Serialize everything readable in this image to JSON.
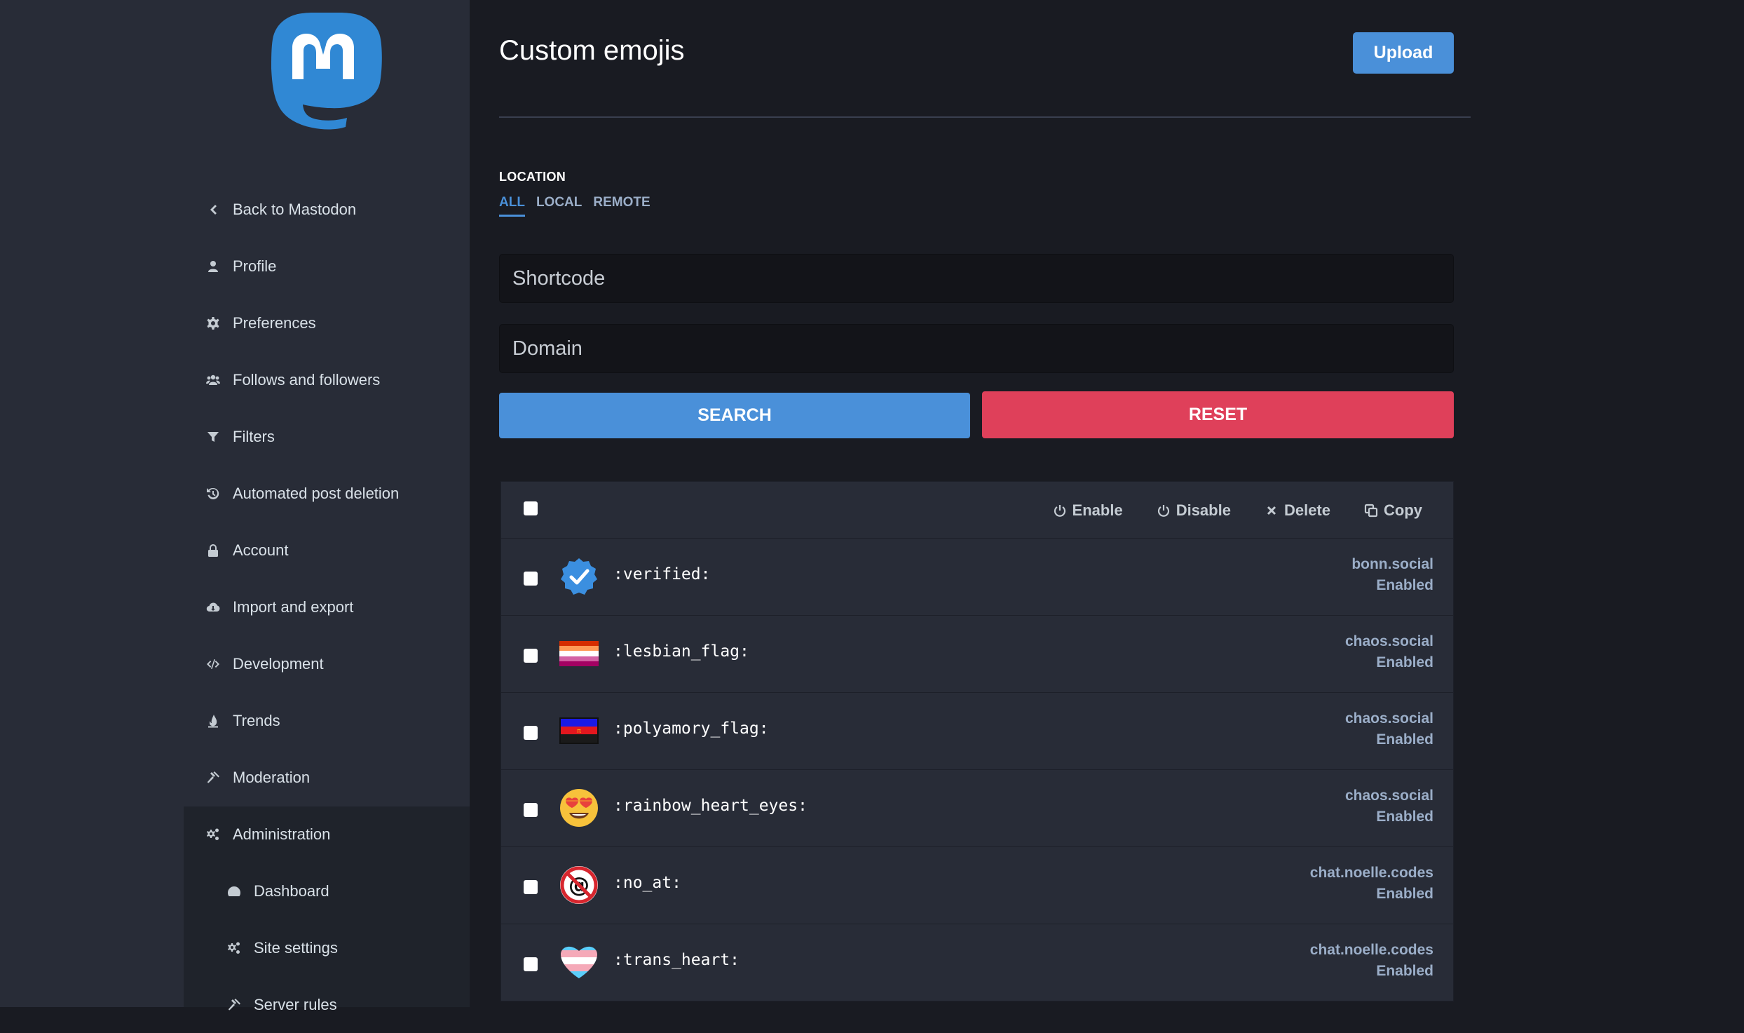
{
  "sidebar": {
    "logo": "mastodon-logo",
    "items": [
      {
        "label": "Back to Mastodon",
        "icon": "chevron-left-icon"
      },
      {
        "label": "Profile",
        "icon": "user-icon"
      },
      {
        "label": "Preferences",
        "icon": "cog-icon"
      },
      {
        "label": "Follows and followers",
        "icon": "users-icon"
      },
      {
        "label": "Filters",
        "icon": "filter-icon"
      },
      {
        "label": "Automated post deletion",
        "icon": "history-icon"
      },
      {
        "label": "Account",
        "icon": "lock-icon"
      },
      {
        "label": "Import and export",
        "icon": "cloud-download-icon"
      },
      {
        "label": "Development",
        "icon": "code-icon"
      },
      {
        "label": "Trends",
        "icon": "fire-icon"
      },
      {
        "label": "Moderation",
        "icon": "gavel-icon"
      },
      {
        "label": "Administration",
        "icon": "cogs-icon"
      },
      {
        "label": "Dashboard",
        "icon": "tachometer-icon"
      },
      {
        "label": "Site settings",
        "icon": "cogs-icon"
      },
      {
        "label": "Server rules",
        "icon": "gavel-icon"
      }
    ]
  },
  "header": {
    "title": "Custom emojis",
    "upload_label": "Upload"
  },
  "filter": {
    "heading": "LOCATION",
    "links": [
      "ALL",
      "LOCAL",
      "REMOTE"
    ],
    "selected": "ALL"
  },
  "search": {
    "shortcode_placeholder": "Shortcode",
    "domain_placeholder": "Domain",
    "search_label": "SEARCH",
    "reset_label": "RESET"
  },
  "batch_actions": {
    "enable": "Enable",
    "disable": "Disable",
    "delete": "Delete",
    "copy": "Copy"
  },
  "emojis": [
    {
      "shortcode": ":verified:",
      "domain": "bonn.social",
      "status": "Enabled",
      "icon": "verified-badge-icon"
    },
    {
      "shortcode": ":lesbian_flag:",
      "domain": "chaos.social",
      "status": "Enabled",
      "icon": "lesbian-flag-icon"
    },
    {
      "shortcode": ":polyamory_flag:",
      "domain": "chaos.social",
      "status": "Enabled",
      "icon": "polyamory-flag-icon"
    },
    {
      "shortcode": ":rainbow_heart_eyes:",
      "domain": "chaos.social",
      "status": "Enabled",
      "icon": "rainbow-heart-eyes-icon"
    },
    {
      "shortcode": ":no_at:",
      "domain": "chat.noelle.codes",
      "status": "Enabled",
      "icon": "no-at-icon"
    },
    {
      "shortcode": ":trans_heart:",
      "domain": "chat.noelle.codes",
      "status": "Enabled",
      "icon": "trans-heart-icon"
    }
  ],
  "colors": {
    "accent": "#4a90d9",
    "danger": "#df405a",
    "sidebar_bg": "#282c37",
    "page_bg": "#191b22"
  }
}
